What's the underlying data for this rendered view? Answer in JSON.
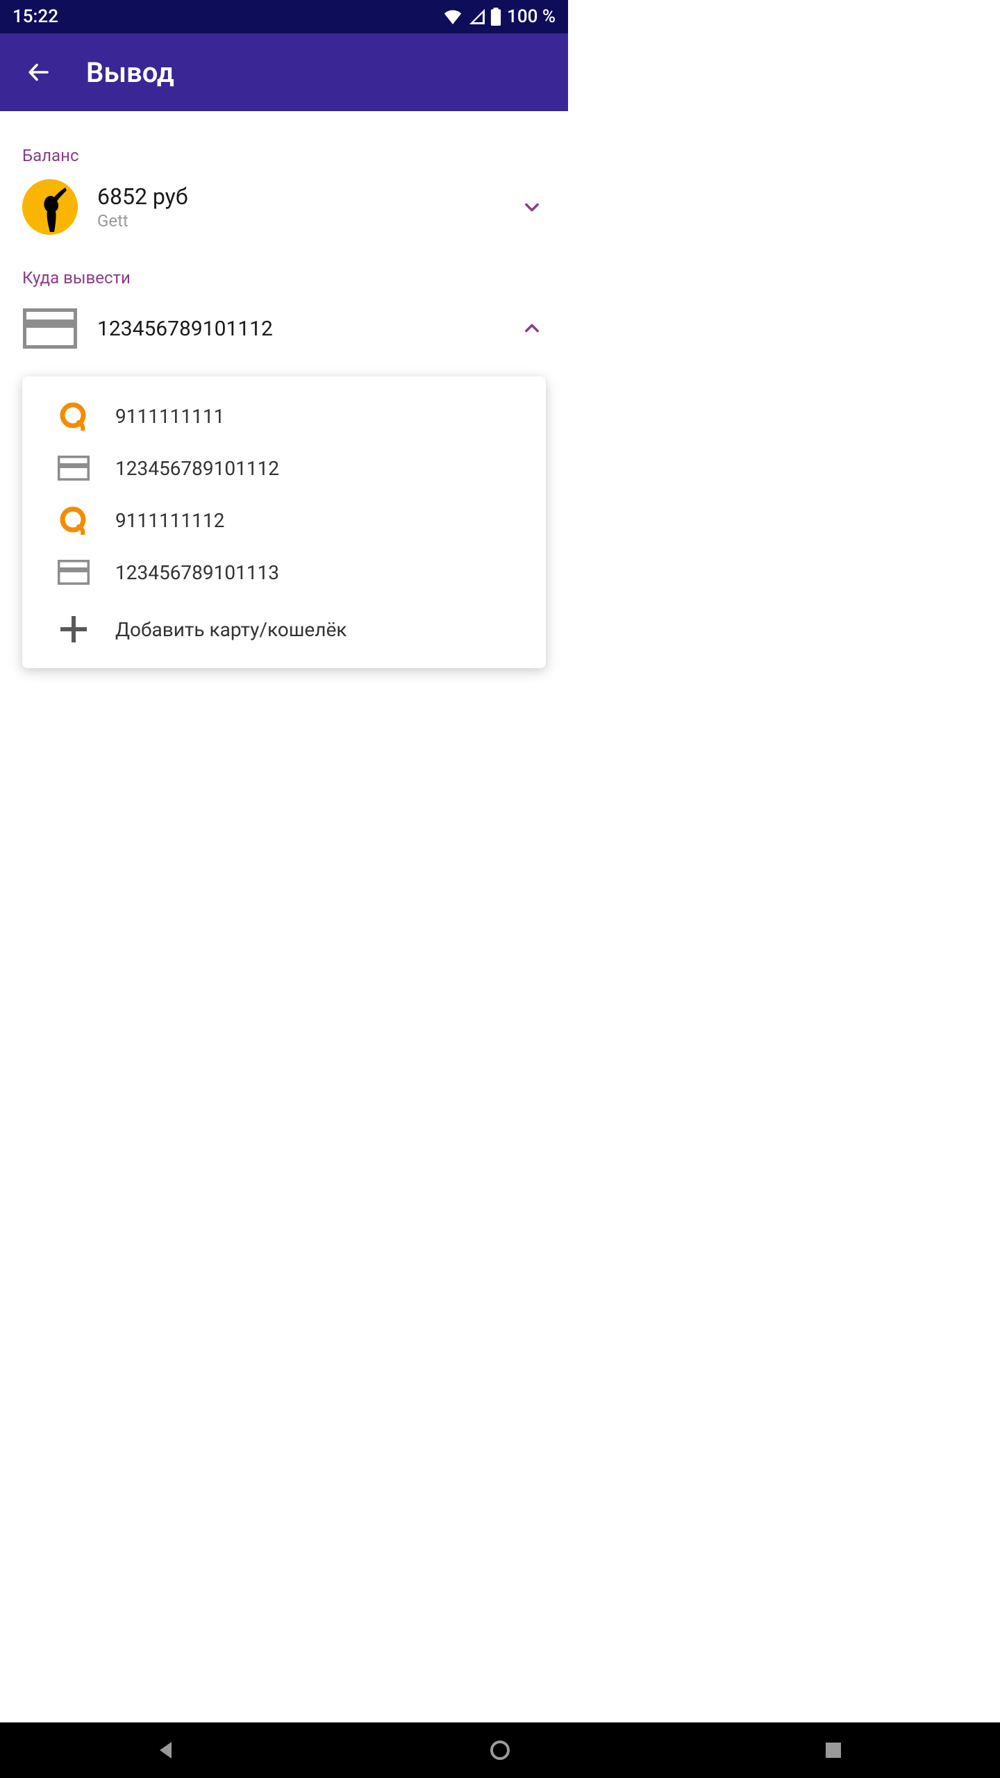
{
  "status": {
    "time": "15:22",
    "battery": "100 %"
  },
  "appbar": {
    "title": "Вывод"
  },
  "balance": {
    "label": "Баланс",
    "amount": "6852 руб",
    "source": "Gett"
  },
  "destination": {
    "label": "Куда вывести",
    "selected": "123456789101112"
  },
  "dropdown": {
    "items": [
      {
        "type": "qiwi",
        "label": "9111111111"
      },
      {
        "type": "card",
        "label": "123456789101112"
      },
      {
        "type": "qiwi",
        "label": "9111111112"
      },
      {
        "type": "card",
        "label": "123456789101113"
      }
    ],
    "add_label": "Добавить карту/кошелёк"
  }
}
